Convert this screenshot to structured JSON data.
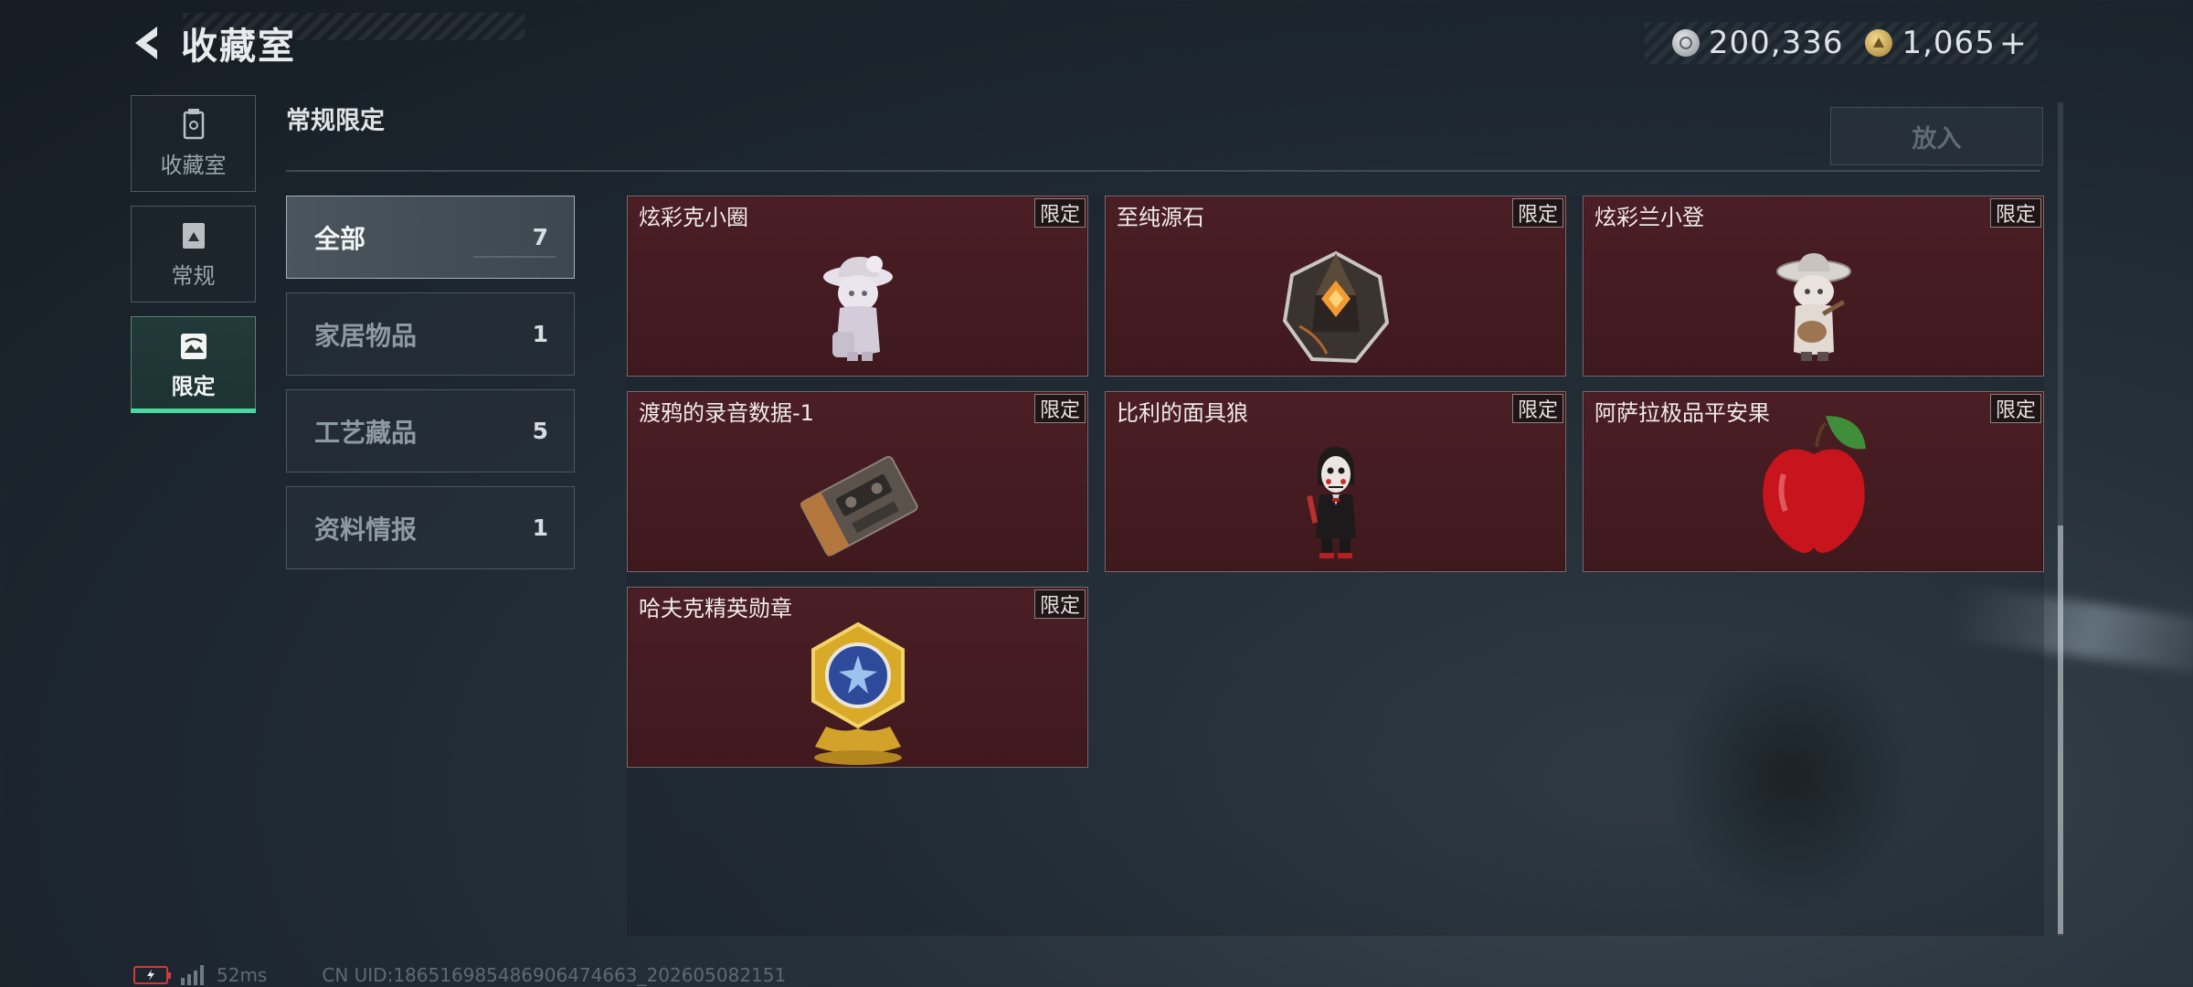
{
  "header": {
    "title": "收藏室",
    "currency": [
      {
        "icon": "silver-coin-icon",
        "value": "200,336"
      },
      {
        "icon": "gold-coin-icon",
        "value": "1,065"
      }
    ],
    "add_symbol": "+"
  },
  "side_nav": [
    {
      "label": "收藏室",
      "icon": "trophy-icon",
      "active": false
    },
    {
      "label": "常规",
      "icon": "album-icon",
      "active": false
    },
    {
      "label": "限定",
      "icon": "image-icon",
      "active": true
    }
  ],
  "section": {
    "title": "常规限定",
    "place_button": "放入"
  },
  "categories": [
    {
      "name": "全部",
      "count": "7",
      "active": true
    },
    {
      "name": "家居物品",
      "count": "1",
      "active": false
    },
    {
      "name": "工艺藏品",
      "count": "5",
      "active": false
    },
    {
      "name": "资料情报",
      "count": "1",
      "active": false
    }
  ],
  "items": [
    {
      "name": "炫彩克小圈",
      "tag": "限定",
      "icon": "figurine-girl-icon"
    },
    {
      "name": "至纯源石",
      "tag": "限定",
      "icon": "crystal-stone-icon"
    },
    {
      "name": "炫彩兰小登",
      "tag": "限定",
      "icon": "figurine-guitar-icon"
    },
    {
      "name": "渡鸦的录音数据-1",
      "tag": "限定",
      "icon": "cassette-tape-icon"
    },
    {
      "name": "比利的面具狼",
      "tag": "限定",
      "icon": "puppet-figure-icon"
    },
    {
      "name": "阿萨拉极品平安果",
      "tag": "限定",
      "icon": "apple-icon"
    },
    {
      "name": "哈夫克精英勋章",
      "tag": "限定",
      "icon": "medal-icon"
    }
  ],
  "footer": {
    "ping": "52ms",
    "uid": "CN UID:1865169854869064746​63_202605082151"
  },
  "colors": {
    "accent": "#49d8a0",
    "card_bg": "#4a1e24",
    "battery_alert": "#d23a3a"
  }
}
